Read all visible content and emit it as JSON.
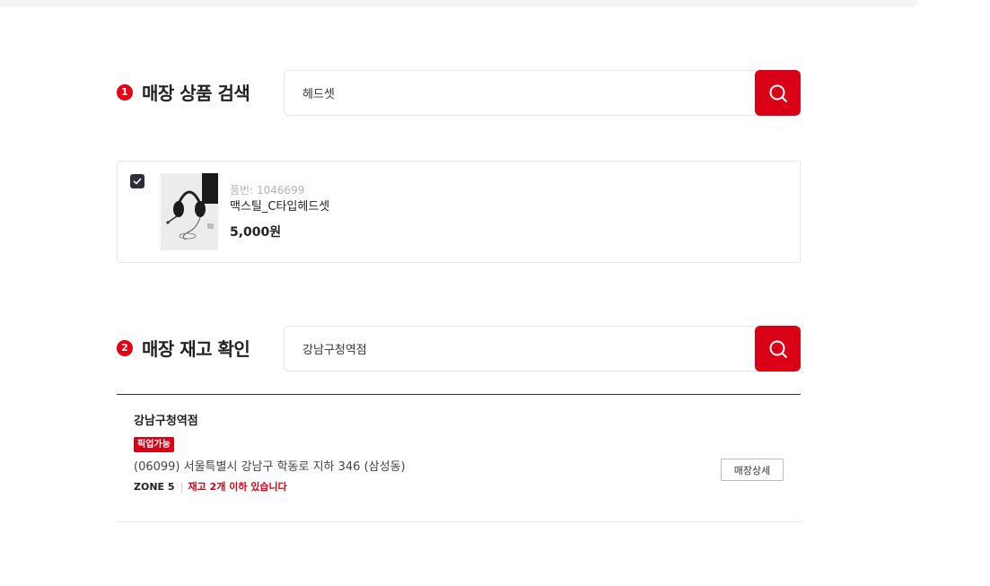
{
  "section1": {
    "step": "1",
    "title": "매장 상품 검색",
    "search_value": "헤드셋"
  },
  "product": {
    "code_label": "품번: 1046699",
    "name": "맥스틸_C타입헤드셋",
    "price": "5,000원",
    "checked": true
  },
  "section2": {
    "step": "2",
    "title": "매장 재고 확인",
    "search_value": "강남구청역점"
  },
  "store": {
    "name": "강남구청역점",
    "badge": "픽업가능",
    "address": "(06099) 서울특별시 강남구 학동로 지하 346 (삼성동)",
    "zone": "ZONE 5",
    "stock_text": "재고 2개 이하 있습니다",
    "detail_button": "매장상세"
  },
  "colors": {
    "accent": "#da0016",
    "checkbox": "#2d2f3b"
  },
  "icons": {
    "search": "search-icon",
    "check": "check-icon"
  }
}
